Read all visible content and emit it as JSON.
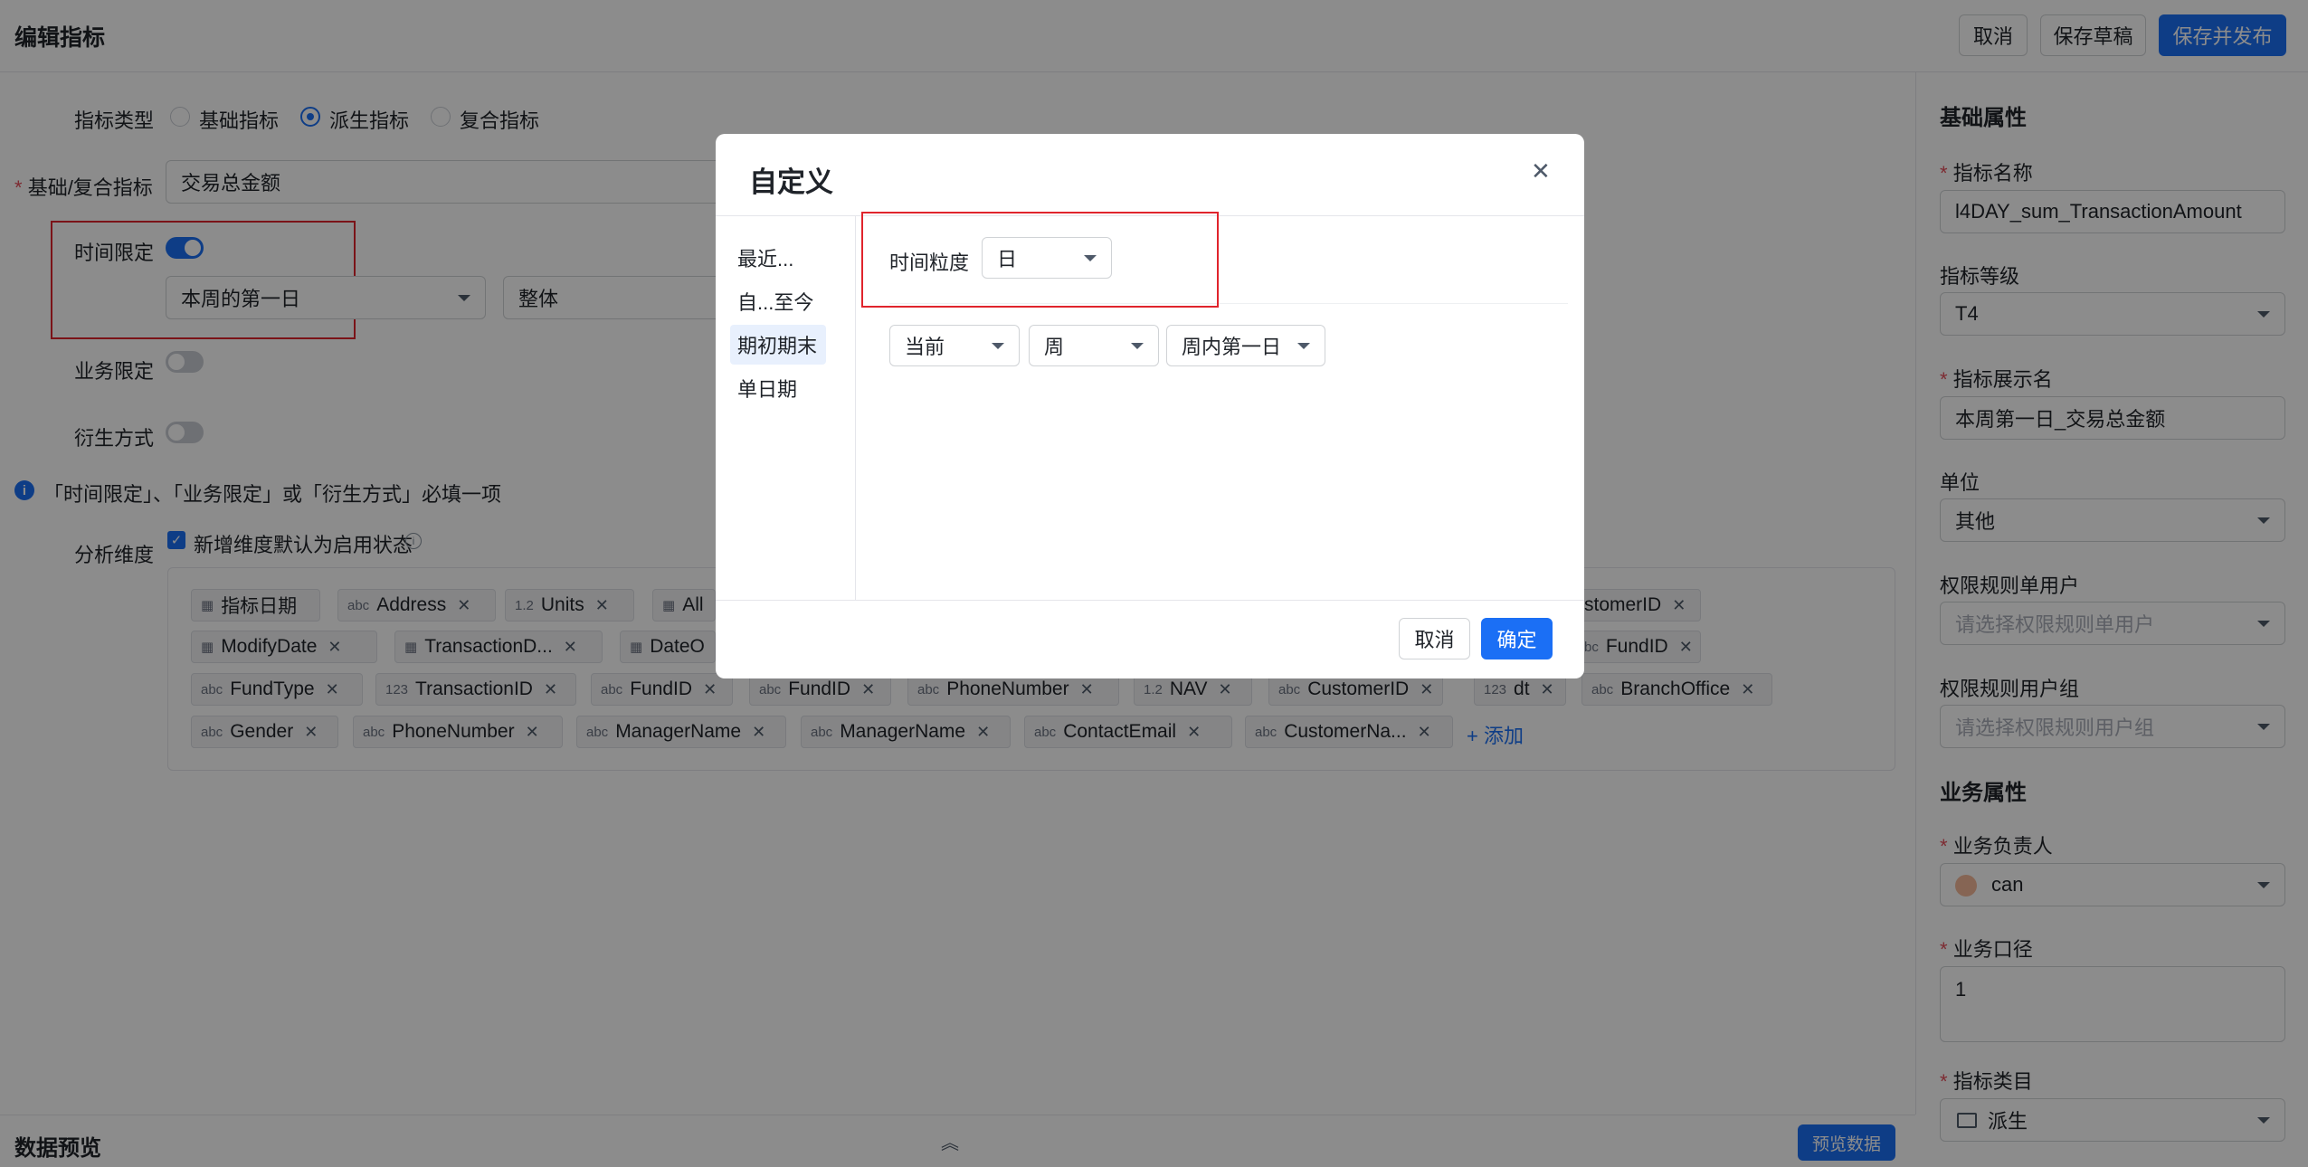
{
  "header": {
    "title": "编辑指标",
    "cancel": "取消",
    "save_draft": "保存草稿",
    "save_publish": "保存并发布"
  },
  "form": {
    "type_label": "指标类型",
    "type_options": [
      "基础指标",
      "派生指标",
      "复合指标"
    ],
    "type_selected": "派生指标",
    "base_label": "基础/复合指标",
    "base_value": "交易总金额",
    "time_label": "时间限定",
    "time_enabled": true,
    "time_select": "本周的第一日",
    "time_select2": "整体",
    "business_label": "业务限定",
    "business_enabled": false,
    "derive_label": "衍生方式",
    "derive_enabled": false,
    "notice": "「时间限定」、「业务限定」或「衍生方式」必填一项",
    "dims_label": "分析维度",
    "dims_checkbox": "新增维度默认为启用状态",
    "add_label": "+ 添加"
  },
  "dimensions": [
    {
      "icon": "calendar-icon",
      "label": "指标日期"
    },
    {
      "icon": "abc",
      "label": "Address"
    },
    {
      "icon": "1.2",
      "label": "Units"
    },
    {
      "icon": "calendar-icon",
      "label": "All"
    },
    {
      "icon": "abc",
      "label": "stomerID"
    },
    {
      "icon": "calendar-icon",
      "label": "ModifyDate"
    },
    {
      "icon": "calendar-icon",
      "label": "TransactionD..."
    },
    {
      "icon": "calendar-icon",
      "label": "DateO"
    },
    {
      "icon": "abc",
      "label": "FundID"
    },
    {
      "icon": "abc",
      "label": "FundType"
    },
    {
      "icon": "123",
      "label": "TransactionID"
    },
    {
      "icon": "abc",
      "label": "FundID"
    },
    {
      "icon": "abc",
      "label": "FundID"
    },
    {
      "icon": "abc",
      "label": "PhoneNumber"
    },
    {
      "icon": "1.2",
      "label": "NAV"
    },
    {
      "icon": "abc",
      "label": "CustomerID"
    },
    {
      "icon": "123",
      "label": "dt"
    },
    {
      "icon": "abc",
      "label": "BranchOffice"
    },
    {
      "icon": "abc",
      "label": "Gender"
    },
    {
      "icon": "abc",
      "label": "PhoneNumber"
    },
    {
      "icon": "abc",
      "label": "ManagerName"
    },
    {
      "icon": "abc",
      "label": "ManagerName"
    },
    {
      "icon": "abc",
      "label": "ContactEmail"
    },
    {
      "icon": "abc",
      "label": "CustomerNa..."
    }
  ],
  "right": {
    "basic_title": "基础属性",
    "name_label": "指标名称",
    "name_value": "l4DAY_sum_TransactionAmount",
    "level_label": "指标等级",
    "level_value": "T4",
    "display_label": "指标展示名",
    "display_value": "本周第一日_交易总金额",
    "unit_label": "单位",
    "unit_value": "其他",
    "perm_user_label": "权限规则单用户",
    "perm_user_placeholder": "请选择权限规则单用户",
    "perm_group_label": "权限规则用户组",
    "perm_group_placeholder": "请选择权限规则用户组",
    "biz_title": "业务属性",
    "owner_label": "业务负责人",
    "owner_value": "can",
    "caliber_label": "业务口径",
    "caliber_value": "1",
    "category_label": "指标类目",
    "category_value": "派生"
  },
  "preview": {
    "title": "数据预览",
    "button": "预览数据"
  },
  "modal": {
    "title": "自定义",
    "nav": [
      "最近...",
      "自...至今",
      "期初期末",
      "单日期"
    ],
    "nav_selected": "期初期末",
    "granularity_label": "时间粒度",
    "granularity_value": "日",
    "sel1": "当前",
    "sel2": "周",
    "sel3": "周内第一日",
    "cancel": "取消",
    "confirm": "确定"
  }
}
